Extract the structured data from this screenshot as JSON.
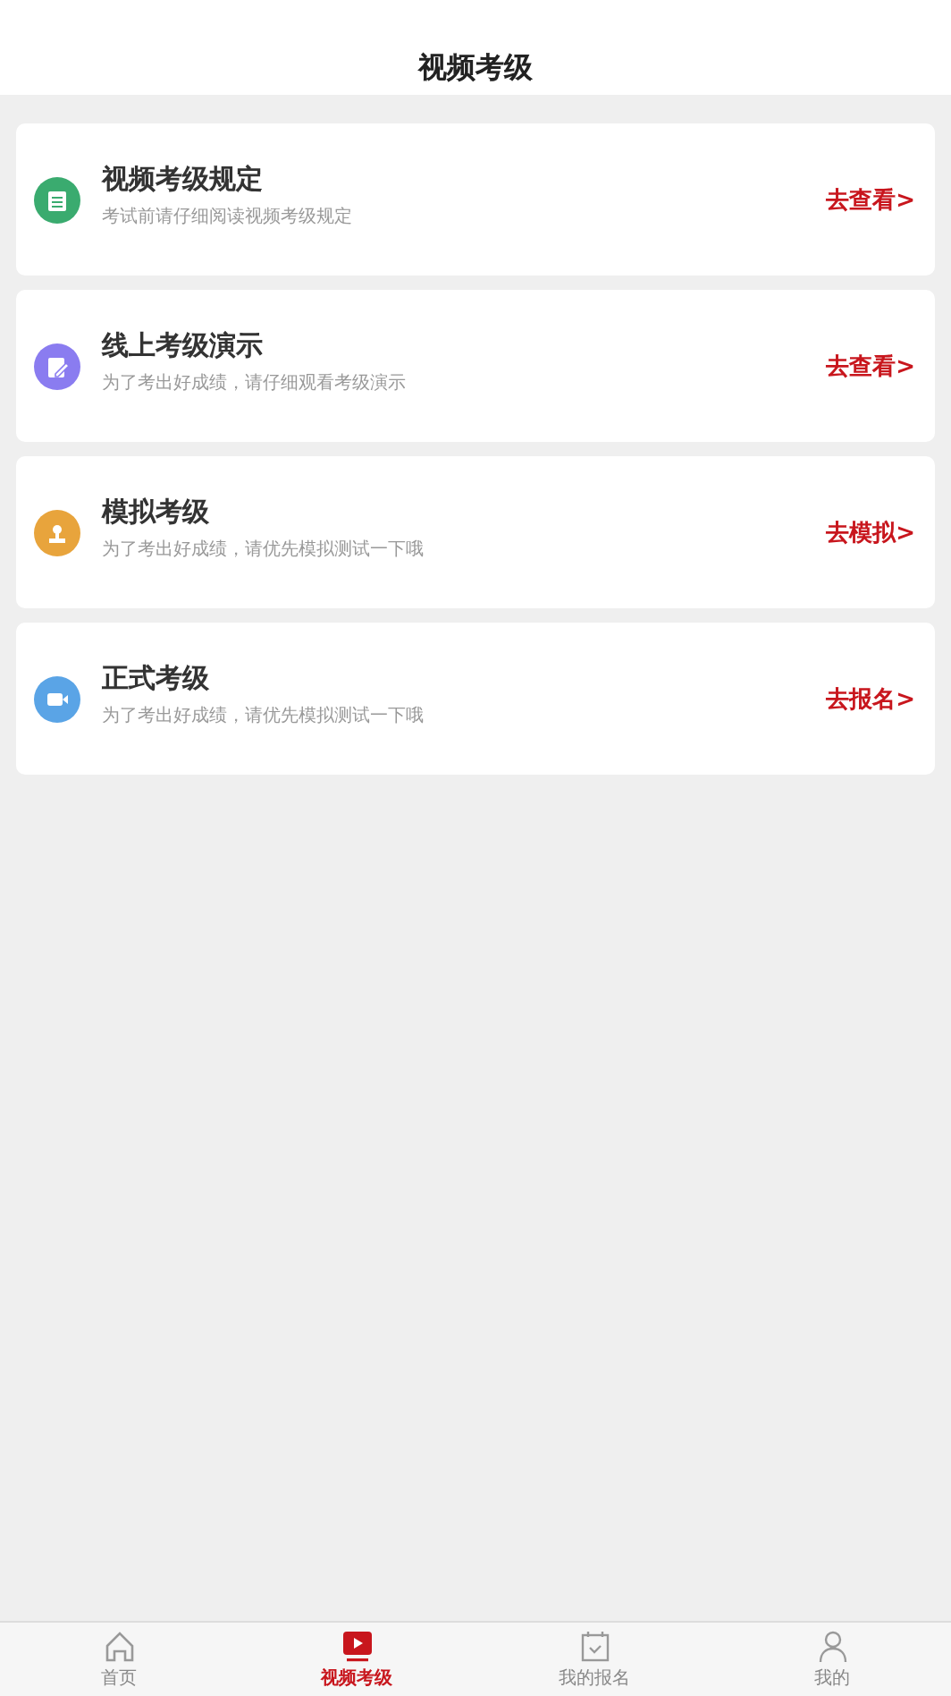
{
  "header": {
    "title": "视频考级"
  },
  "cards": [
    {
      "title": "视频考级规定",
      "subtitle": "考试前请仔细阅读视频考级规定",
      "action": "去查看>",
      "kind": "notes",
      "color": "#3aab6f"
    },
    {
      "title": "线上考级演示",
      "subtitle": "为了考出好成绩，请仔细观看考级演示",
      "action": "去查看>",
      "kind": "edit",
      "color": "#8a7cf0"
    },
    {
      "title": "模拟考级",
      "subtitle": "为了考出好成绩，请优先模拟测试一下哦",
      "action": "去模拟>",
      "kind": "stamp",
      "color": "#e8a43c"
    },
    {
      "title": "正式考级",
      "subtitle": "为了考出好成绩，请优先模拟测试一下哦",
      "action": "去报名>",
      "kind": "video",
      "color": "#5aa4e6"
    }
  ],
  "tabbar": [
    {
      "label": "首页",
      "kind": "home",
      "selected": false
    },
    {
      "label": "视频考级",
      "kind": "play",
      "selected": true
    },
    {
      "label": "我的报名",
      "kind": "calendar",
      "selected": false
    },
    {
      "label": "我的",
      "kind": "user",
      "selected": false
    }
  ]
}
